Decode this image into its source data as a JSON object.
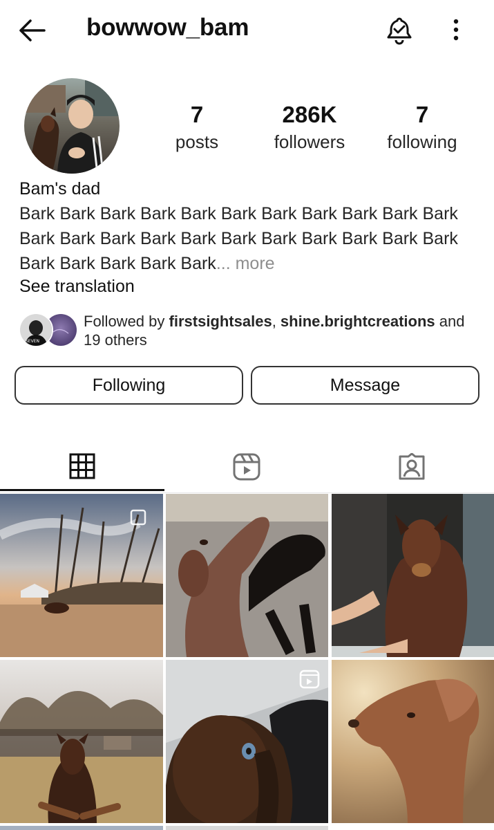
{
  "header": {
    "username": "bowwow_bam",
    "icons": [
      "arrow-left-icon",
      "bell-check-icon",
      "more-vertical-icon"
    ]
  },
  "stats": {
    "posts": {
      "value": "7",
      "label": "posts"
    },
    "followers": {
      "value": "286K",
      "label": "followers"
    },
    "following": {
      "value": "7",
      "label": "following"
    }
  },
  "bio": {
    "display_name": "Bam's dad",
    "text": "Bark Bark Bark Bark Bark Bark Bark Bark Bark Bark Bark Bark Bark Bark Bark Bark Bark Bark Bark Bark Bark Bark Bark Bark Bark Bark Bark",
    "more": "... more",
    "see_translation": "See translation"
  },
  "followed_by": {
    "prefix": "Followed by ",
    "user1": "firstsightsales",
    "separator": ", ",
    "user2": "shine.brightcreations",
    "suffix": " and",
    "others": "19 others",
    "avatar_text": "SEVEN"
  },
  "actions": {
    "following_label": "Following",
    "message_label": "Message"
  },
  "tabs": [
    {
      "name": "grid",
      "icon": "grid-icon",
      "active": true
    },
    {
      "name": "reels",
      "icon": "reels-icon",
      "active": false
    },
    {
      "name": "tagged",
      "icon": "tagged-person-icon",
      "active": false
    }
  ],
  "colors": {
    "text": "#111111",
    "muted": "#8e8e8e",
    "border": "#333333"
  }
}
